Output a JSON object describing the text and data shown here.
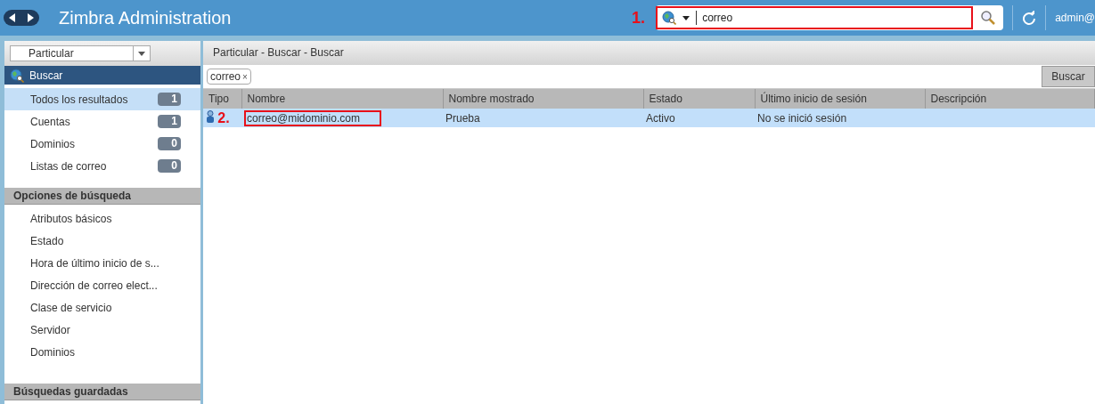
{
  "header": {
    "title": "Zimbra Administration",
    "search": {
      "value": "correo",
      "annotation": "1."
    },
    "user": "admin@"
  },
  "sidebar": {
    "dropdown": "Particular",
    "current": "Buscar",
    "results": [
      {
        "label": "Todos los resultados",
        "count": "1",
        "selected": true
      },
      {
        "label": "Cuentas",
        "count": "1",
        "selected": false
      },
      {
        "label": "Dominios",
        "count": "0",
        "selected": false
      },
      {
        "label": "Listas de correo",
        "count": "0",
        "selected": false
      }
    ],
    "sections": [
      {
        "title": "Opciones de búsqueda",
        "items": [
          "Atributos básicos",
          "Estado",
          "Hora de último inicio de s...",
          "Dirección de correo elect...",
          "Clase de servicio",
          "Servidor",
          "Dominios"
        ]
      },
      {
        "title": "Búsquedas guardadas"
      }
    ]
  },
  "main": {
    "breadcrumb": "Particular - Buscar - Buscar",
    "chip": "correo",
    "chip_close": "×",
    "search_button": "Buscar",
    "table": {
      "columns": [
        "Tipo",
        "Nombre",
        "Nombre mostrado",
        "Estado",
        "Último inicio de sesión",
        "Descripción"
      ],
      "rows": [
        {
          "kind": "account",
          "annotation": "2.",
          "cells": [
            "",
            "correo@midominio.com",
            "Prueba",
            "Activo",
            "No se inició sesión"
          ],
          "selected": true
        }
      ]
    }
  }
}
